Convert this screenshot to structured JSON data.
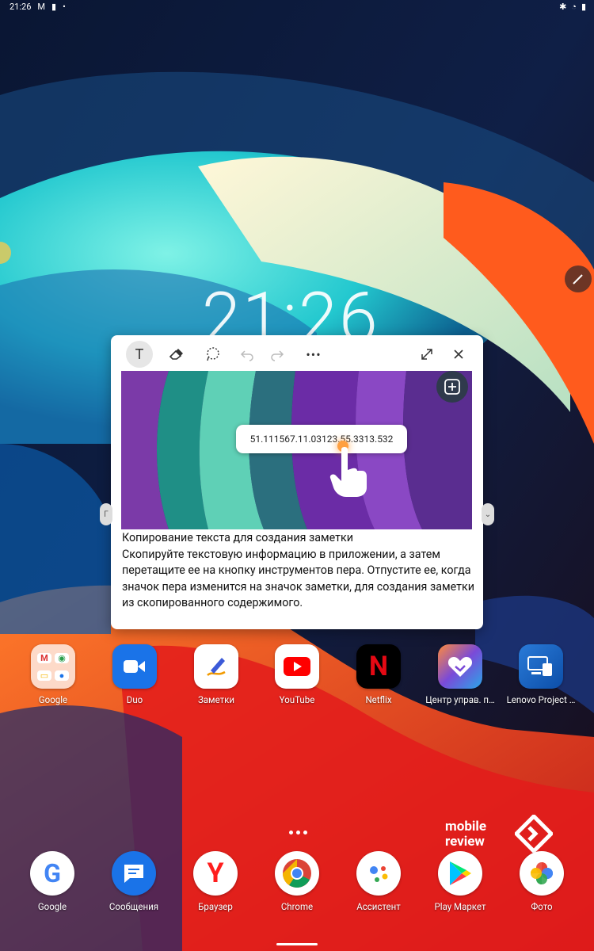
{
  "status_bar": {
    "time": "21:26",
    "icons": [
      "gmail-icon",
      "notification-icon",
      "dot-icon",
      "bluetooth-icon",
      "wifi-icon",
      "battery-icon"
    ]
  },
  "lockclock": {
    "time": "21:26"
  },
  "pen_popup": {
    "toolbar": {
      "text_tool_label": "T",
      "tools": [
        "text-tool-icon",
        "eraser-icon",
        "lasso-icon",
        "undo-icon",
        "redo-icon",
        "more-icon",
        "expand-icon",
        "close-icon"
      ]
    },
    "preview": {
      "copied_text": "51.111567.11.03123.55.3313.532"
    },
    "description": {
      "title": "Копирование текста для создания заметки",
      "body": "Скопируйте текстовую информацию в приложении, а затем перетащите ее на кнопку инструментов пера. Отпустите ее, когда значок пера изменится на значок заметки, для создания заметки из скопированного содержимого."
    }
  },
  "home_apps": [
    {
      "label": "Google",
      "icon": "google-folder-icon"
    },
    {
      "label": "Duo",
      "icon": "duo-icon"
    },
    {
      "label": "Заметки",
      "icon": "notes-icon"
    },
    {
      "label": "YouTube",
      "icon": "youtube-icon"
    },
    {
      "label": "Netflix",
      "icon": "netflix-icon"
    },
    {
      "label": "Центр управ. п…",
      "icon": "control-center-icon"
    },
    {
      "label": "Lenovo Project …",
      "icon": "lenovo-project-icon"
    }
  ],
  "dock_apps": [
    {
      "label": "Google",
      "icon": "google-icon"
    },
    {
      "label": "Сообщения",
      "icon": "messages-icon"
    },
    {
      "label": "Браузер",
      "icon": "yandex-browser-icon"
    },
    {
      "label": "Chrome",
      "icon": "chrome-icon"
    },
    {
      "label": "Ассистент",
      "icon": "assistant-icon"
    },
    {
      "label": "Play Маркет",
      "icon": "play-store-icon"
    },
    {
      "label": "Фото",
      "icon": "photos-icon"
    }
  ],
  "watermark": {
    "line1": "mobile",
    "line2": "review"
  },
  "colors": {
    "popup_bg": "#ffffff",
    "wallpaper_dark": "#0b1530",
    "wallpaper_cyan": "#2fd8d0",
    "wallpaper_orange": "#ff5a1f",
    "wallpaper_red": "#e31b1b"
  }
}
